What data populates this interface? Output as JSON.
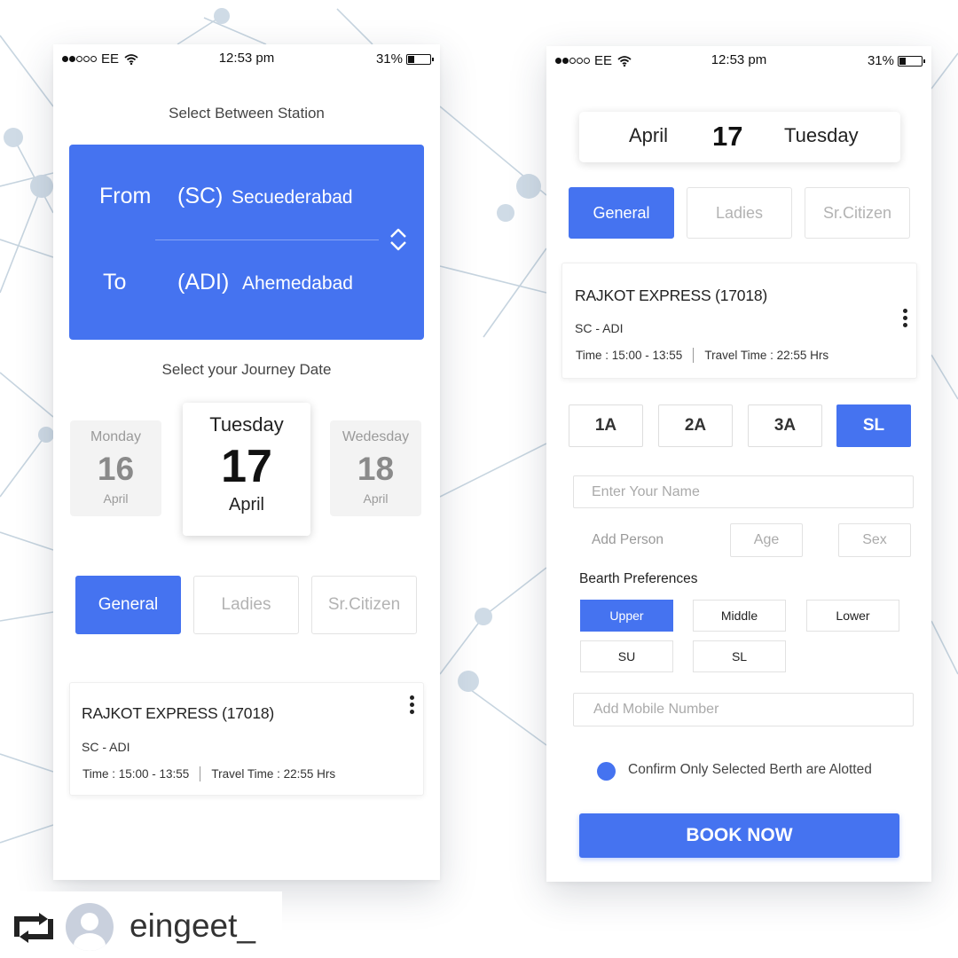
{
  "colors": {
    "accent": "#4573f0",
    "background": "#ffffff"
  },
  "status_bar": {
    "carrier": "EE",
    "time": "12:53 pm",
    "battery": "31%",
    "battery_level": 0.31,
    "signal_bars": 2
  },
  "left": {
    "title": "Select Between Station",
    "from": {
      "label": "From",
      "code": "(SC)",
      "name": "Secuederabad"
    },
    "to": {
      "label": "To",
      "code": "(ADI)",
      "name": "Ahemedabad"
    },
    "date_title": "Select your Journey Date",
    "dates": [
      {
        "day": "Monday",
        "num": "16",
        "month": "April"
      },
      {
        "day": "Tuesday",
        "num": "17",
        "month": "April"
      },
      {
        "day": "Wedesday",
        "num": "18",
        "month": "April"
      }
    ],
    "categories": [
      "General",
      "Ladies",
      "Sr.Citizen"
    ],
    "train": {
      "name": "RAJKOT EXPRESS (17018)",
      "route": "SC - ADI",
      "time": "Time : 15:00 - 13:55",
      "travel_time": "Travel Time : 22:55 Hrs"
    }
  },
  "right": {
    "date": {
      "month": "April",
      "num": "17",
      "day": "Tuesday"
    },
    "categories": [
      "General",
      "Ladies",
      "Sr.Citizen"
    ],
    "train": {
      "name": "RAJKOT EXPRESS (17018)",
      "route": "SC - ADI",
      "time": "Time : 15:00 - 13:55",
      "travel_time": "Travel Time : 22:55 Hrs"
    },
    "classes": [
      "1A",
      "2A",
      "3A",
      "SL"
    ],
    "name_placeholder": "Enter Your Name",
    "add_person": "Add Person",
    "age_placeholder": "Age",
    "sex_placeholder": "Sex",
    "berth_title": "Bearth Preferences",
    "berths": [
      "Upper",
      "Middle",
      "Lower",
      "SU",
      "SL"
    ],
    "mobile_placeholder": "Add Mobile Number",
    "confirm_text": "Confirm Only Selected Berth are Alotted",
    "book_label": "BOOK NOW"
  },
  "repost": {
    "icon": "repost-icon",
    "username": "eingeet_"
  }
}
